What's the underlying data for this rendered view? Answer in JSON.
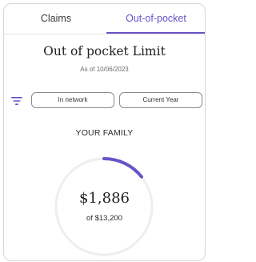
{
  "tabs": [
    {
      "label": "Claims",
      "active": false
    },
    {
      "label": "Out-of-pocket",
      "active": true
    }
  ],
  "header": {
    "title": "Out of pocket Limit",
    "as_of": "As of 10/06/2023"
  },
  "filters": {
    "icon": "filter-icon",
    "network": "In network",
    "period": "Current Year"
  },
  "summary": {
    "heading": "YOUR FAMILY",
    "spent": "$1,886",
    "limit": "of $13,200",
    "progress_fraction": 0.143
  },
  "colors": {
    "accent": "#6a52c8",
    "track": "#eeeeee"
  }
}
